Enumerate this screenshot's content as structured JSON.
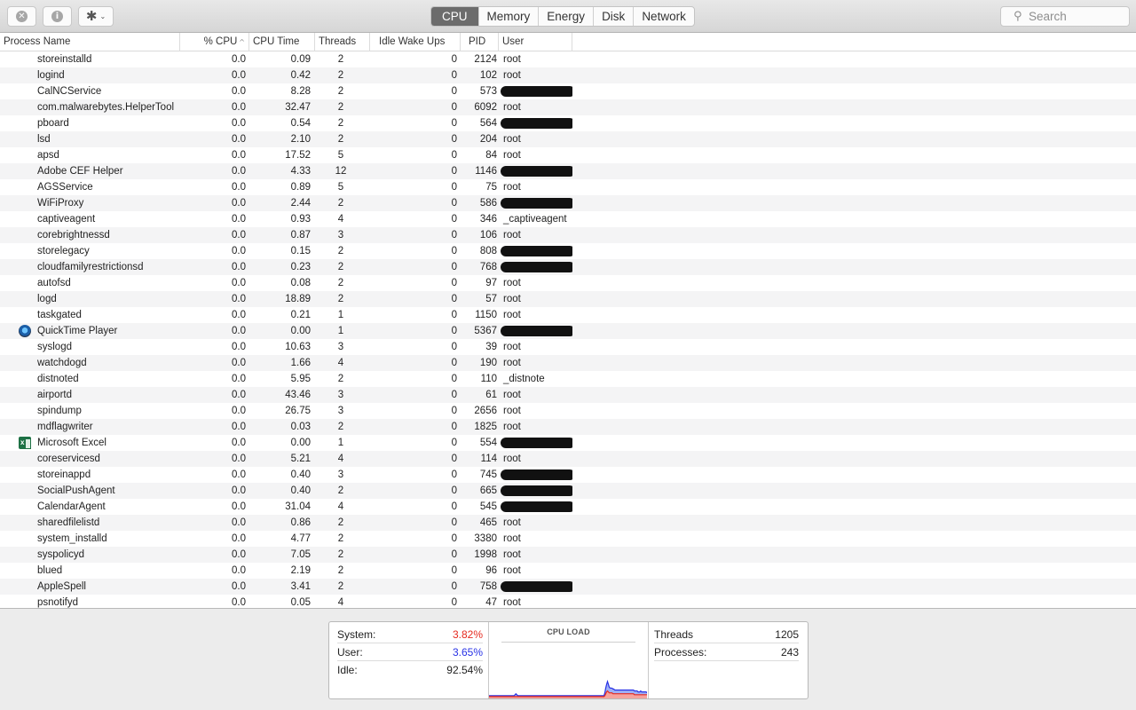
{
  "toolbar": {
    "buttons": [
      {
        "name": "stop-process",
        "icon": "close-icon",
        "glyph": "✕"
      },
      {
        "name": "inspect-process",
        "icon": "info-icon",
        "glyph": "i"
      },
      {
        "name": "actions",
        "icon": "gear-icon",
        "glyph": "✱",
        "chevron": "⌄"
      }
    ],
    "tabs": [
      {
        "label": "CPU",
        "active": true
      },
      {
        "label": "Memory",
        "active": false
      },
      {
        "label": "Energy",
        "active": false
      },
      {
        "label": "Disk",
        "active": false
      },
      {
        "label": "Network",
        "active": false
      }
    ],
    "search": {
      "placeholder": "Search",
      "icon": "⚲"
    }
  },
  "table": {
    "columns": [
      "Process Name",
      "% CPU",
      "CPU Time",
      "Threads",
      "Idle Wake Ups",
      "PID",
      "User"
    ],
    "sort_indicator": "^",
    "rows": [
      {
        "name": "storeinstalld",
        "cpu": "0.0",
        "time": "0.09",
        "threads": "2",
        "wake": "0",
        "pid": "2124",
        "user": "root"
      },
      {
        "name": "logind",
        "cpu": "0.0",
        "time": "0.42",
        "threads": "2",
        "wake": "0",
        "pid": "102",
        "user": "root"
      },
      {
        "name": "CalNCService",
        "cpu": "0.0",
        "time": "8.28",
        "threads": "2",
        "wake": "0",
        "pid": "573",
        "user": null
      },
      {
        "name": "com.malwarebytes.HelperTool",
        "cpu": "0.0",
        "time": "32.47",
        "threads": "2",
        "wake": "0",
        "pid": "6092",
        "user": "root"
      },
      {
        "name": "pboard",
        "cpu": "0.0",
        "time": "0.54",
        "threads": "2",
        "wake": "0",
        "pid": "564",
        "user": null
      },
      {
        "name": "lsd",
        "cpu": "0.0",
        "time": "2.10",
        "threads": "2",
        "wake": "0",
        "pid": "204",
        "user": "root"
      },
      {
        "name": "apsd",
        "cpu": "0.0",
        "time": "17.52",
        "threads": "5",
        "wake": "0",
        "pid": "84",
        "user": "root"
      },
      {
        "name": "Adobe CEF Helper",
        "cpu": "0.0",
        "time": "4.33",
        "threads": "12",
        "wake": "0",
        "pid": "1146",
        "user": null
      },
      {
        "name": "AGSService",
        "cpu": "0.0",
        "time": "0.89",
        "threads": "5",
        "wake": "0",
        "pid": "75",
        "user": "root"
      },
      {
        "name": "WiFiProxy",
        "cpu": "0.0",
        "time": "2.44",
        "threads": "2",
        "wake": "0",
        "pid": "586",
        "user": null
      },
      {
        "name": "captiveagent",
        "cpu": "0.0",
        "time": "0.93",
        "threads": "4",
        "wake": "0",
        "pid": "346",
        "user": "_captiveagent"
      },
      {
        "name": "corebrightnessd",
        "cpu": "0.0",
        "time": "0.87",
        "threads": "3",
        "wake": "0",
        "pid": "106",
        "user": "root"
      },
      {
        "name": "storelegacy",
        "cpu": "0.0",
        "time": "0.15",
        "threads": "2",
        "wake": "0",
        "pid": "808",
        "user": null
      },
      {
        "name": "cloudfamilyrestrictionsd",
        "cpu": "0.0",
        "time": "0.23",
        "threads": "2",
        "wake": "0",
        "pid": "768",
        "user": null
      },
      {
        "name": "autofsd",
        "cpu": "0.0",
        "time": "0.08",
        "threads": "2",
        "wake": "0",
        "pid": "97",
        "user": "root"
      },
      {
        "name": "logd",
        "cpu": "0.0",
        "time": "18.89",
        "threads": "2",
        "wake": "0",
        "pid": "57",
        "user": "root"
      },
      {
        "name": "taskgated",
        "cpu": "0.0",
        "time": "0.21",
        "threads": "1",
        "wake": "0",
        "pid": "1150",
        "user": "root"
      },
      {
        "name": "QuickTime Player",
        "icon": "quicktime",
        "cpu": "0.0",
        "time": "0.00",
        "threads": "1",
        "wake": "0",
        "pid": "5367",
        "user": null
      },
      {
        "name": "syslogd",
        "cpu": "0.0",
        "time": "10.63",
        "threads": "3",
        "wake": "0",
        "pid": "39",
        "user": "root"
      },
      {
        "name": "watchdogd",
        "cpu": "0.0",
        "time": "1.66",
        "threads": "4",
        "wake": "0",
        "pid": "190",
        "user": "root"
      },
      {
        "name": "distnoted",
        "cpu": "0.0",
        "time": "5.95",
        "threads": "2",
        "wake": "0",
        "pid": "110",
        "user": "_distnote"
      },
      {
        "name": "airportd",
        "cpu": "0.0",
        "time": "43.46",
        "threads": "3",
        "wake": "0",
        "pid": "61",
        "user": "root"
      },
      {
        "name": "spindump",
        "cpu": "0.0",
        "time": "26.75",
        "threads": "3",
        "wake": "0",
        "pid": "2656",
        "user": "root"
      },
      {
        "name": "mdflagwriter",
        "cpu": "0.0",
        "time": "0.03",
        "threads": "2",
        "wake": "0",
        "pid": "1825",
        "user": "root"
      },
      {
        "name": "Microsoft Excel",
        "icon": "excel",
        "cpu": "0.0",
        "time": "0.00",
        "threads": "1",
        "wake": "0",
        "pid": "554",
        "user": null
      },
      {
        "name": "coreservicesd",
        "cpu": "0.0",
        "time": "5.21",
        "threads": "4",
        "wake": "0",
        "pid": "114",
        "user": "root"
      },
      {
        "name": "storeinappd",
        "cpu": "0.0",
        "time": "0.40",
        "threads": "3",
        "wake": "0",
        "pid": "745",
        "user": null
      },
      {
        "name": "SocialPushAgent",
        "cpu": "0.0",
        "time": "0.40",
        "threads": "2",
        "wake": "0",
        "pid": "665",
        "user": null
      },
      {
        "name": "CalendarAgent",
        "cpu": "0.0",
        "time": "31.04",
        "threads": "4",
        "wake": "0",
        "pid": "545",
        "user": null
      },
      {
        "name": "sharedfilelistd",
        "cpu": "0.0",
        "time": "0.86",
        "threads": "2",
        "wake": "0",
        "pid": "465",
        "user": "root"
      },
      {
        "name": "system_installd",
        "cpu": "0.0",
        "time": "4.77",
        "threads": "2",
        "wake": "0",
        "pid": "3380",
        "user": "root"
      },
      {
        "name": "syspolicyd",
        "cpu": "0.0",
        "time": "7.05",
        "threads": "2",
        "wake": "0",
        "pid": "1998",
        "user": "root"
      },
      {
        "name": "blued",
        "cpu": "0.0",
        "time": "2.19",
        "threads": "2",
        "wake": "0",
        "pid": "96",
        "user": "root"
      },
      {
        "name": "AppleSpell",
        "cpu": "0.0",
        "time": "3.41",
        "threads": "2",
        "wake": "0",
        "pid": "758",
        "user": null
      },
      {
        "name": "psnotifyd",
        "cpu": "0.0",
        "time": "0.05",
        "threads": "4",
        "wake": "0",
        "pid": "47",
        "user": "root"
      }
    ]
  },
  "summary": {
    "system_label": "System:",
    "system_value": "3.82%",
    "user_label": "User:",
    "user_value": "3.65%",
    "idle_label": "Idle:",
    "idle_value": "92.54%",
    "graph_title": "CPU LOAD",
    "threads_label": "Threads",
    "threads_value": "1205",
    "processes_label": "Processes:",
    "processes_value": "243",
    "colors": {
      "system": "#e62a1f",
      "user": "#2832e6"
    }
  },
  "chart_data": {
    "type": "area",
    "title": "CPU LOAD",
    "ylim": [
      0,
      100
    ],
    "series": [
      {
        "name": "System",
        "color": "#e62a1f",
        "values": [
          1,
          1,
          1,
          1,
          1,
          1,
          1,
          1,
          1,
          1,
          1,
          1,
          1,
          1,
          1,
          1,
          1,
          1,
          1,
          1,
          1,
          1,
          1,
          1,
          1,
          1,
          1,
          1,
          1,
          1,
          1,
          1,
          1,
          1,
          1,
          1,
          1,
          1,
          1,
          1,
          1,
          1,
          1,
          1,
          1,
          1,
          1,
          1,
          1,
          1,
          1,
          1,
          1,
          1,
          1,
          1,
          1,
          1,
          1,
          1,
          1,
          1,
          1,
          1,
          1,
          1,
          1,
          1,
          1,
          1,
          1,
          1,
          1,
          1,
          1,
          1,
          1,
          1,
          1,
          1,
          1,
          1,
          1,
          1,
          1,
          1,
          1,
          1,
          1,
          1,
          1,
          1,
          1,
          1,
          1,
          1,
          1,
          1,
          1,
          1,
          1,
          1,
          1,
          1,
          1,
          1,
          1,
          1,
          1,
          1,
          1,
          1,
          1,
          1,
          1,
          1,
          1,
          1,
          1,
          1,
          1,
          1,
          1,
          1,
          1,
          1,
          1,
          1,
          1,
          2,
          4,
          6,
          7,
          6,
          5,
          5,
          5,
          5,
          4,
          4,
          4,
          4,
          4,
          4,
          4,
          4,
          4,
          4,
          4,
          4,
          4,
          4,
          4,
          4,
          4,
          4,
          4,
          4,
          4,
          4,
          4,
          4,
          3,
          3,
          3,
          3,
          3,
          3,
          3,
          3,
          3,
          3,
          3,
          3,
          3,
          3,
          3
        ]
      },
      {
        "name": "User",
        "color": "#2832e6",
        "values": [
          1,
          1,
          1,
          1,
          1,
          1,
          1,
          1,
          1,
          1,
          1,
          1,
          1,
          1,
          1,
          1,
          1,
          1,
          1,
          1,
          1,
          1,
          1,
          1,
          1,
          1,
          1,
          1,
          1,
          2,
          3,
          2,
          1,
          1,
          1,
          1,
          1,
          1,
          1,
          1,
          1,
          1,
          1,
          1,
          1,
          1,
          1,
          1,
          1,
          1,
          1,
          1,
          1,
          1,
          1,
          1,
          1,
          1,
          1,
          1,
          1,
          1,
          1,
          1,
          1,
          1,
          1,
          1,
          1,
          1,
          1,
          1,
          1,
          1,
          1,
          1,
          1,
          1,
          1,
          1,
          1,
          1,
          1,
          1,
          1,
          1,
          1,
          1,
          1,
          1,
          1,
          1,
          1,
          1,
          1,
          1,
          1,
          1,
          1,
          1,
          1,
          1,
          1,
          1,
          1,
          1,
          1,
          1,
          1,
          1,
          1,
          1,
          1,
          1,
          1,
          1,
          1,
          1,
          1,
          1,
          1,
          1,
          1,
          1,
          1,
          1,
          1,
          1,
          1,
          3,
          6,
          8,
          10,
          8,
          6,
          5,
          5,
          5,
          5,
          5,
          4,
          4,
          4,
          4,
          4,
          4,
          4,
          4,
          4,
          4,
          4,
          4,
          4,
          4,
          4,
          4,
          4,
          4,
          4,
          4,
          4,
          4,
          4,
          4,
          4,
          4,
          3,
          3,
          3,
          4,
          3,
          3,
          3,
          3,
          3,
          3,
          2
        ]
      }
    ]
  }
}
